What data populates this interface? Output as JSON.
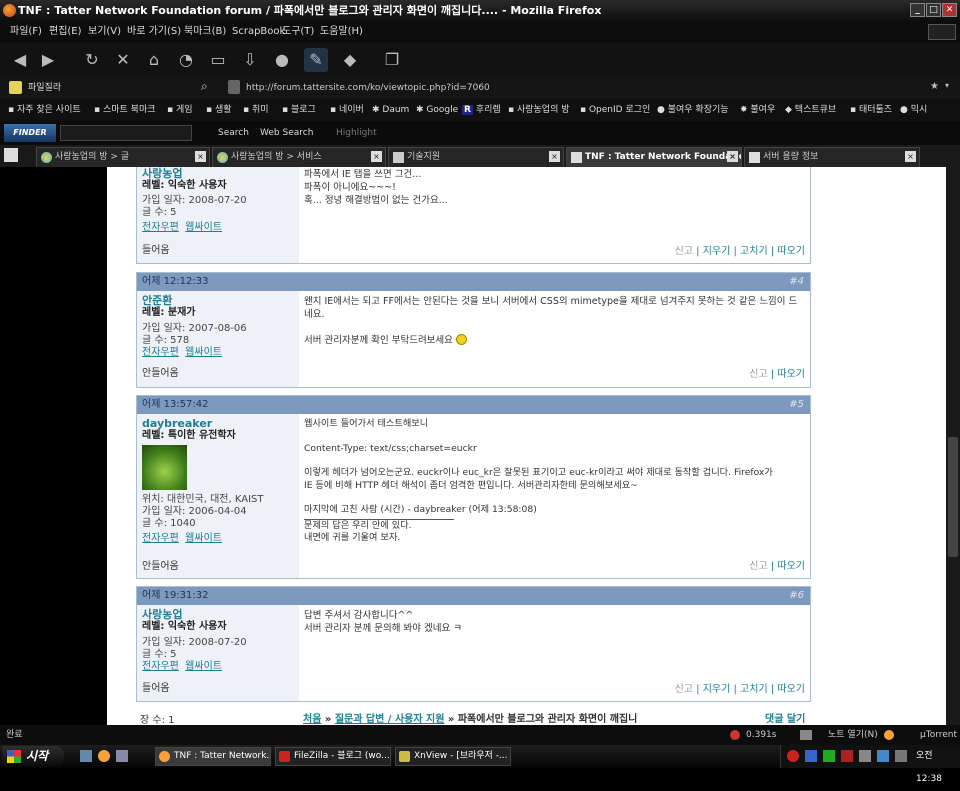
{
  "window": {
    "title": "TNF : Tatter Network Foundation forum / 파폭에서만 블로그와 관리자 화면이 깨집니다.... - Mozilla Firefox",
    "min": "_",
    "max": "□",
    "close": "✕"
  },
  "menu": [
    "파일(F)",
    "편집(E)",
    "보기(V)",
    "바로 가기(S)",
    "북마크(B)",
    "ScrapBook",
    "도구(T)",
    "도움말(H)"
  ],
  "address": {
    "search_text": "파일질라",
    "url": "http://forum.tattersite.com/ko/viewtopic.php?id=7060"
  },
  "bookmarks": [
    "자주 찾은 사이트",
    "스마트 북마크",
    "게임",
    "생활",
    "취미",
    "블로그",
    "네이버",
    "Daum",
    "Google",
    "후리렙",
    "사랑농업의 방",
    "OpenID 로그인",
    "불여우 확장기능",
    "불여우",
    "텍스트큐브",
    "태터툴즈",
    "믹시"
  ],
  "toolbar2": {
    "logo": "FINDER",
    "search": "Search",
    "web_search": "Web Search",
    "highlight": "Highlight"
  },
  "tabs": [
    {
      "label": "사랑농업의 방 > 글"
    },
    {
      "label": "사랑농업의 방 > 서비스"
    },
    {
      "label": "기술지원"
    },
    {
      "label": "TNF : Tatter Network Foundatio..."
    },
    {
      "label": "서버 용량 정보"
    }
  ],
  "posts": [
    {
      "user": "사랑농업",
      "level": "레벨: 익숙한 사용자",
      "joined": "가입 일자: 2008-07-20",
      "count": "글 수: 5",
      "email": "전자우편",
      "website": "웹싸이트",
      "status": "들어옴",
      "body": [
        "파폭에서 IE 탭을 쓰면 그건...",
        "파폭이 아니에요~~~!",
        "혹... 정녕 해결방법이 없는 건가요..."
      ],
      "actions": [
        "신고",
        "지우기",
        "고치기",
        "따오기"
      ]
    },
    {
      "time": "어제 12:12:33",
      "num": "#4",
      "user": "안준환",
      "level": "레벨: 분재가",
      "joined": "가입 일자: 2007-08-06",
      "count": "글 수: 578",
      "email": "전자우편",
      "website": "웹싸이트",
      "status": "안들어옴",
      "body": [
        "왠지 IE에서는 되고 FF에서는 안된다는 것을 보니 서버에서 CSS의 mimetype을 제대로 넘겨주지 못하는 것 같은 느낌이 드",
        "네요.",
        "",
        "서버 관리자분께 확인 부탁드려보세요"
      ],
      "actions": [
        "신고",
        "따오기"
      ]
    },
    {
      "time": "어제 13:57:42",
      "num": "#5",
      "user": "daybreaker",
      "level": "레벨: 특이한 유전학자",
      "location": "위치: 대한민국, 대전, KAIST",
      "joined": "가입 일자: 2006-04-04",
      "count": "글 수: 1040",
      "email": "전자우편",
      "website": "웹싸이트",
      "status": "안들어옴",
      "body": [
        "웹사이트 들어가서 테스트해보니",
        "",
        "Content-Type: text/css;charset=euckr",
        "",
        "이렇게 헤더가 넘어오는군요. euckr이나 euc_kr은 잘못된 표기이고 euc-kr이라고 써야 제대로 동작할 겁니다. Firefox가",
        "IE 등에 비해 HTTP 헤더 해석이 좀더 엄격한 편입니다. 서버관리자한테 문의해보세요~",
        "",
        "마지막에 고친 사람 (시간) - daybreaker (어제 13:58:08)"
      ],
      "signature": [
        "문제의 답은 우리 안에 있다.",
        "내면에 귀를 기울여 보자."
      ],
      "actions": [
        "신고",
        "따오기"
      ]
    },
    {
      "time": "어제 19:31:32",
      "num": "#6",
      "user": "사랑농업",
      "level": "레벨: 익숙한 사용자",
      "joined": "가입 일자: 2008-07-20",
      "count": "글 수: 5",
      "email": "전자우편",
      "website": "웹싸이트",
      "status": "들어옴",
      "body": [
        "답변 주셔서 감사합니다^^",
        "서버 관리자 분께 문의해 봐야 겠네요 ㅋ"
      ],
      "actions": [
        "신고",
        "지우기",
        "고치기",
        "따오기"
      ]
    }
  ],
  "footer": {
    "pages": "장 수: 1",
    "crumb_home": "처음",
    "crumb_section": "질문과 답변 / 사용자 지원",
    "crumb_topic": "» 파폭에서만 블로그와 관리자 화면이 깨집니",
    "reply": "댓글 달기"
  },
  "statusbar": {
    "left": "완료",
    "time": "0.391s",
    "note": "노트 열기(N)",
    "torrent": "µTorrent"
  },
  "taskbar": {
    "start": "시작",
    "tasks": [
      "TNF : Tatter Network...",
      "FileZilla - 블로그 (wo...",
      "XnView - [브라우저 -..."
    ],
    "clock": "오전 12:38"
  }
}
